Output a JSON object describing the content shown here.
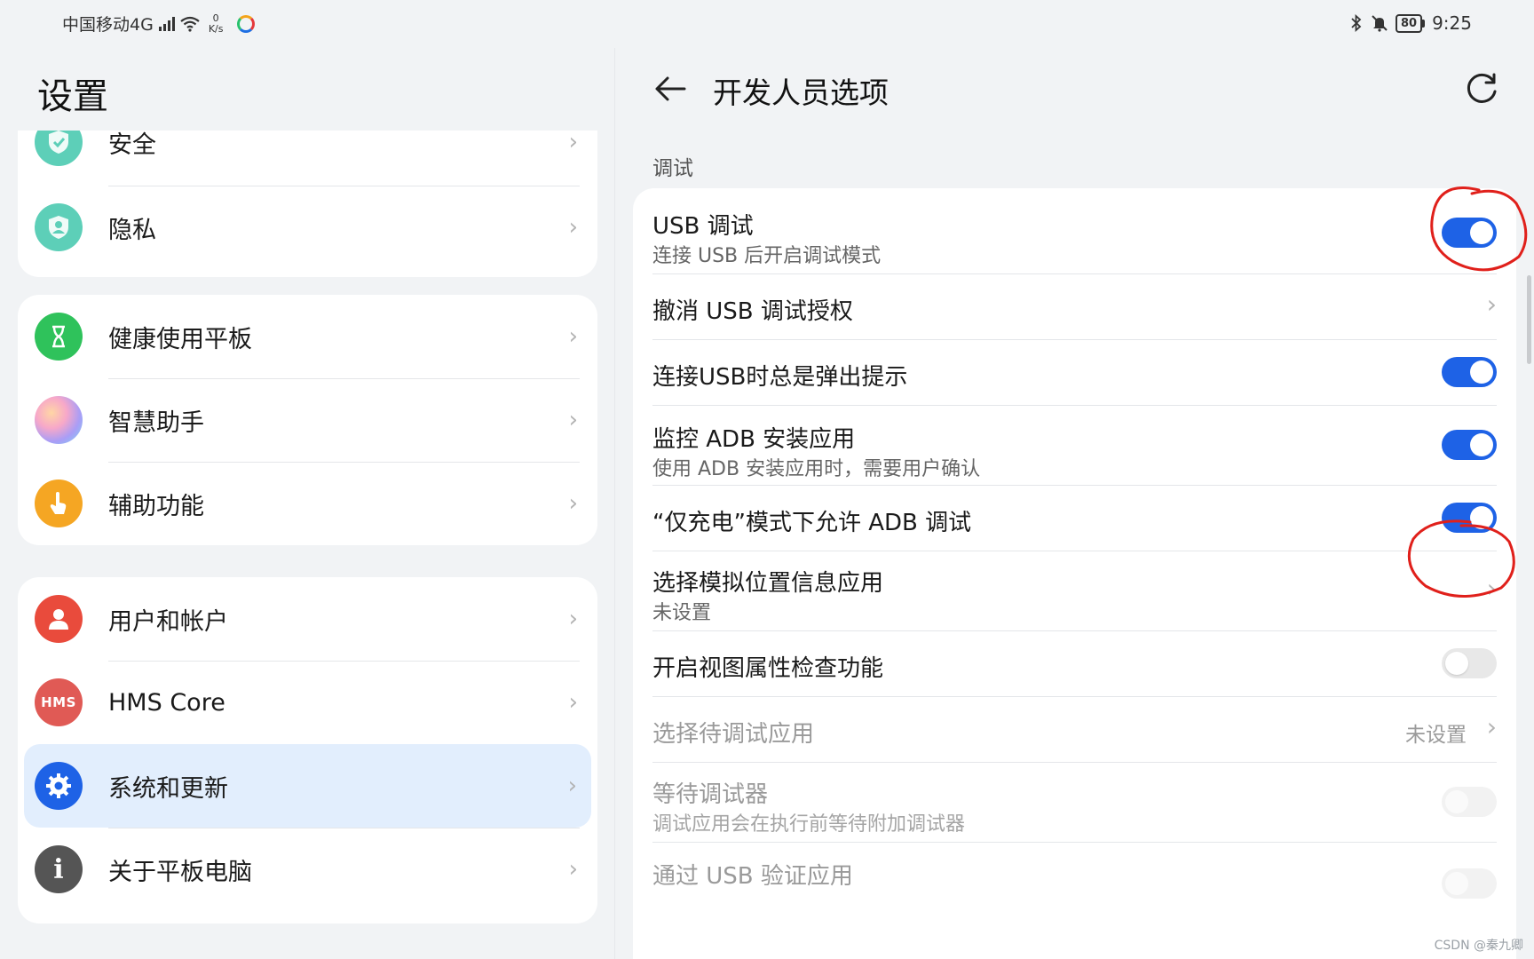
{
  "status_bar": {
    "carrier": "中国移动4G",
    "network_sup": "4G",
    "speed_value": "0",
    "speed_unit": "K/s",
    "battery": "80",
    "time": "9:25"
  },
  "left": {
    "title": "设置",
    "groups": [
      {
        "items": [
          {
            "label": "安全",
            "icon": "shield-check-icon",
            "color": "#5dcfb8"
          },
          {
            "label": "隐私",
            "icon": "privacy-shield-icon",
            "color": "#5dcfb8"
          }
        ]
      },
      {
        "items": [
          {
            "label": "健康使用平板",
            "icon": "hourglass-icon",
            "color": "#2fc25b"
          },
          {
            "label": "智慧助手",
            "icon": "assistant-orb-icon",
            "color": "#c6a2f4"
          },
          {
            "label": "辅助功能",
            "icon": "hand-icon",
            "color": "#f5a623"
          }
        ]
      },
      {
        "items": [
          {
            "label": "用户和帐户",
            "icon": "user-icon",
            "color": "#e94b3c"
          },
          {
            "label": "HMS Core",
            "icon": "hms-icon",
            "icon_text": "HMS",
            "color": "#e05a55"
          },
          {
            "label": "系统和更新",
            "icon": "gear-icon",
            "color": "#1e62e6",
            "selected": true
          },
          {
            "label": "关于平板电脑",
            "icon": "info-icon",
            "icon_text": "i",
            "color": "#555555"
          }
        ]
      }
    ]
  },
  "right": {
    "title": "开发人员选项",
    "section": "调试",
    "rows": [
      {
        "title": "USB 调试",
        "subtitle": "连接 USB 后开启调试模式",
        "control": "toggle",
        "state": "on"
      },
      {
        "title": "撤消 USB 调试授权",
        "control": "chevron"
      },
      {
        "title": "连接USB时总是弹出提示",
        "control": "toggle",
        "state": "on"
      },
      {
        "title": "监控 ADB 安装应用",
        "subtitle": "使用 ADB 安装应用时，需要用户确认",
        "control": "toggle",
        "state": "on"
      },
      {
        "title": "“仅充电”模式下允许 ADB 调试",
        "control": "toggle",
        "state": "on"
      },
      {
        "title": "选择模拟位置信息应用",
        "subtitle": "未设置",
        "control": "chevron"
      },
      {
        "title": "开启视图属性检查功能",
        "control": "toggle",
        "state": "off"
      },
      {
        "title": "选择待调试应用",
        "value": "未设置",
        "control": "chevron",
        "disabled": true
      },
      {
        "title": "等待调试器",
        "subtitle": "调试应用会在执行前等待附加调试器",
        "control": "toggle",
        "state": "ghost",
        "disabled": true
      },
      {
        "title": "通过 USB 验证应用",
        "control": "toggle",
        "state": "ghost",
        "disabled": true
      }
    ]
  },
  "colors": {
    "accent": "#1e62e6",
    "selected_bg": "#e2eefd",
    "annotation": "#e0201b"
  },
  "watermark": "CSDN @秦九卿"
}
